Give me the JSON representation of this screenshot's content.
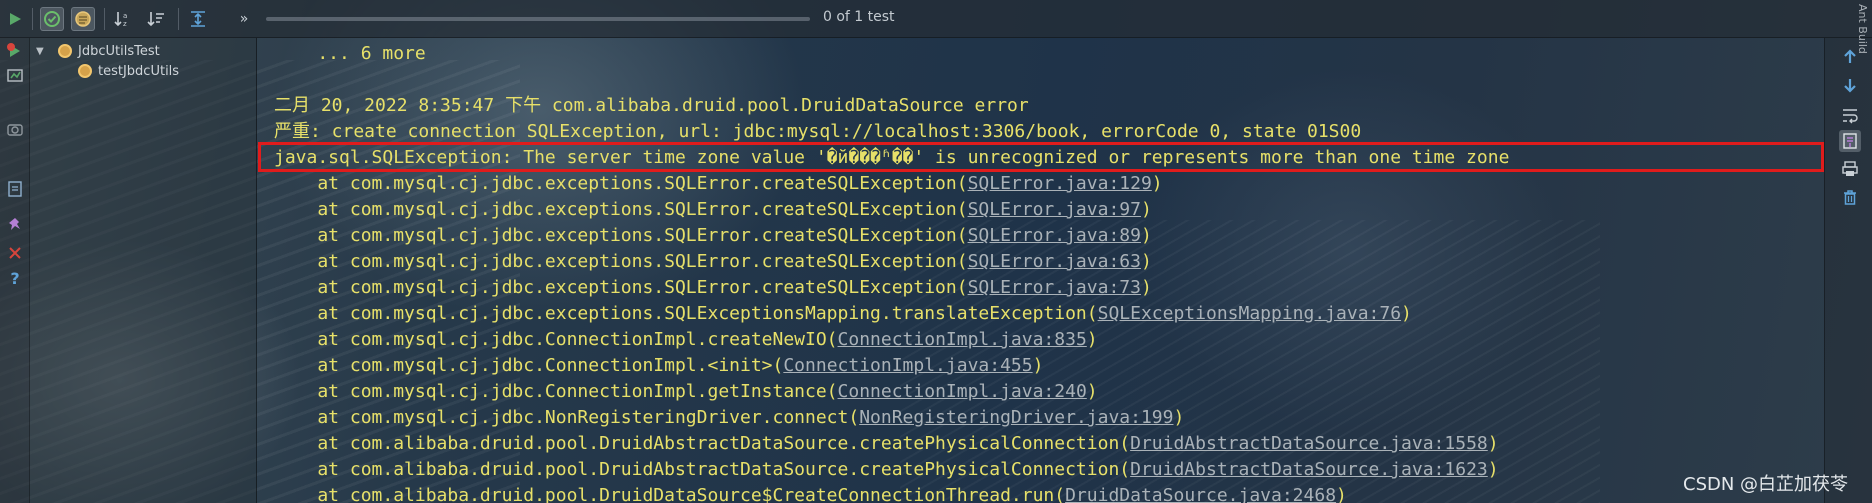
{
  "toolbar": {
    "test_count": "0 of 1 test",
    "progress": 0.0
  },
  "side_label": "Ant Build",
  "tree": {
    "root": "JdbcUtilsTest",
    "child": "testJbdcUtils"
  },
  "console": {
    "lines": [
      {
        "text": "    ... 6 more"
      },
      {
        "text": ""
      },
      {
        "text": "二月 20, 2022 8:35:47 下午 com.alibaba.druid.pool.DruidDataSource error"
      },
      {
        "text": "严重: create connection SQLException, url: jdbc:mysql://localhost:3306/book, errorCode 0, state 01S00"
      },
      {
        "text": "java.sql.SQLException: The server time zone value '�й���ʱ��' is unrecognized or represents more than one time zone"
      },
      {
        "prefix": "    at com.mysql.cj.jdbc.exceptions.SQLError.createSQLException(",
        "link": "SQLError.java:129",
        "suffix": ")"
      },
      {
        "prefix": "    at com.mysql.cj.jdbc.exceptions.SQLError.createSQLException(",
        "link": "SQLError.java:97",
        "suffix": ")"
      },
      {
        "prefix": "    at com.mysql.cj.jdbc.exceptions.SQLError.createSQLException(",
        "link": "SQLError.java:89",
        "suffix": ")"
      },
      {
        "prefix": "    at com.mysql.cj.jdbc.exceptions.SQLError.createSQLException(",
        "link": "SQLError.java:63",
        "suffix": ")"
      },
      {
        "prefix": "    at com.mysql.cj.jdbc.exceptions.SQLError.createSQLException(",
        "link": "SQLError.java:73",
        "suffix": ")"
      },
      {
        "prefix": "    at com.mysql.cj.jdbc.exceptions.SQLExceptionsMapping.translateException(",
        "link": "SQLExceptionsMapping.java:76",
        "suffix": ")"
      },
      {
        "prefix": "    at com.mysql.cj.jdbc.ConnectionImpl.createNewIO(",
        "link": "ConnectionImpl.java:835",
        "suffix": ")"
      },
      {
        "prefix": "    at com.mysql.cj.jdbc.ConnectionImpl.<init>(",
        "link": "ConnectionImpl.java:455",
        "suffix": ")"
      },
      {
        "prefix": "    at com.mysql.cj.jdbc.ConnectionImpl.getInstance(",
        "link": "ConnectionImpl.java:240",
        "suffix": ")"
      },
      {
        "prefix": "    at com.mysql.cj.jdbc.NonRegisteringDriver.connect(",
        "link": "NonRegisteringDriver.java:199",
        "suffix": ")"
      },
      {
        "prefix": "    at com.alibaba.druid.pool.DruidAbstractDataSource.createPhysicalConnection(",
        "link": "DruidAbstractDataSource.java:1558",
        "suffix": ")"
      },
      {
        "prefix": "    at com.alibaba.druid.pool.DruidAbstractDataSource.createPhysicalConnection(",
        "link": "DruidAbstractDataSource.java:1623",
        "suffix": ")"
      },
      {
        "prefix": "    at com.alibaba.druid.pool.DruidDataSource$CreateConnectionThread.run(",
        "link": "DruidDataSource.java:2468",
        "suffix": ")"
      }
    ]
  },
  "watermark": "CSDN @白芷加茯苓",
  "icons": {
    "run": "run-icon",
    "show_passed": "show-passed-icon",
    "show_ignored": "show-ignored-icon",
    "sort_alpha": "sort-alphabetically-icon",
    "sort_duration": "sort-by-duration-icon",
    "expand": "expand-all-icon",
    "more": "more-icon"
  },
  "colors": {
    "console_text": "#e7e069",
    "link": "#aab2b8",
    "highlight_border": "#e01c1c",
    "accent_blue": "#5fa3d9",
    "run_green": "#59a869"
  }
}
